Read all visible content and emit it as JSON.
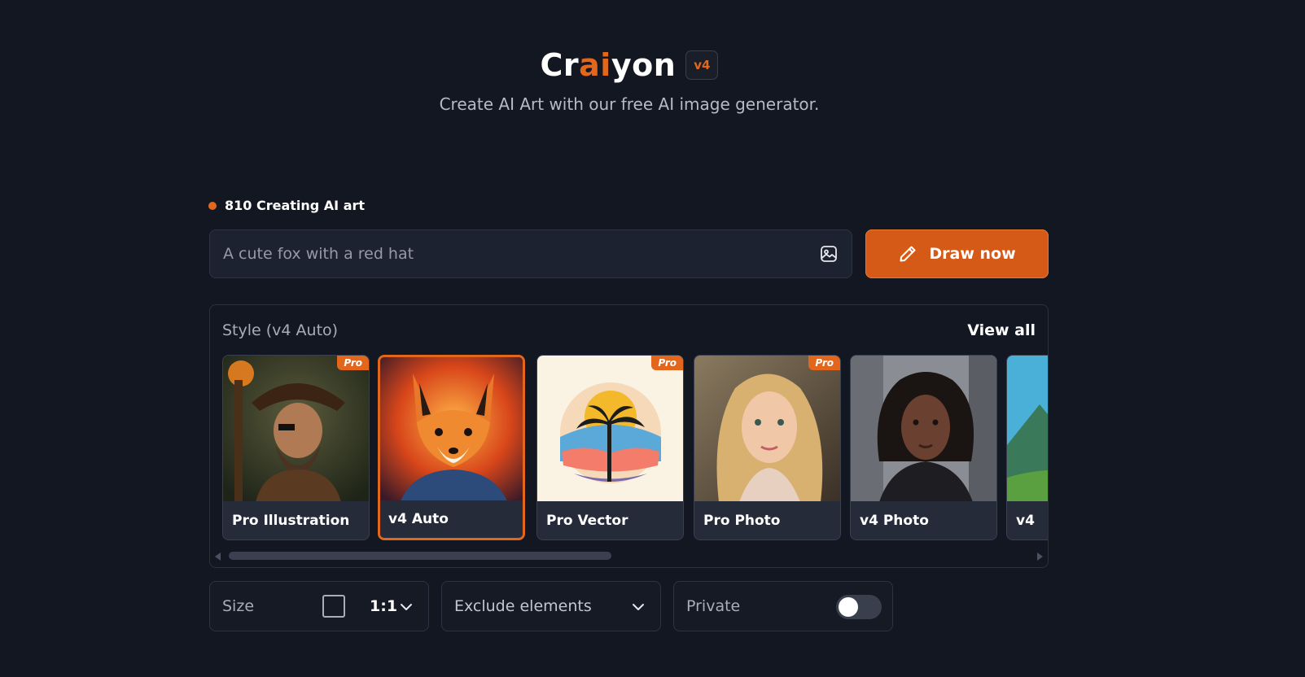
{
  "header": {
    "logo_part1": "Cr",
    "logo_part2": "ai",
    "logo_part3": "yon",
    "version_badge": "v4",
    "subtitle": "Create AI Art with our free AI image generator."
  },
  "status": {
    "count_text": "810 Creating AI art",
    "dot_color": "#e2661c"
  },
  "prompt": {
    "placeholder": "A cute fox with a red hat",
    "value": "",
    "image_icon": "image-upload-icon"
  },
  "draw_button": {
    "label": "Draw now",
    "icon": "pencil-icon",
    "color": "#d65a17"
  },
  "style_panel": {
    "title": "Style (v4 Auto)",
    "view_all": "View all",
    "pro_badge": "Pro",
    "cards": [
      {
        "label": "Pro Illustration",
        "pro": true,
        "selected": false,
        "image": "pirate-portrait-image"
      },
      {
        "label": "v4 Auto",
        "pro": false,
        "selected": true,
        "image": "fox-portrait-image"
      },
      {
        "label": "Pro Vector",
        "pro": true,
        "selected": false,
        "image": "palm-sunset-vector-image"
      },
      {
        "label": "Pro Photo",
        "pro": true,
        "selected": false,
        "image": "blonde-woman-photo-image"
      },
      {
        "label": "v4 Photo",
        "pro": false,
        "selected": false,
        "image": "woman-street-photo-image"
      },
      {
        "label": "v4",
        "pro": false,
        "selected": false,
        "image": "landscape-image"
      }
    ]
  },
  "options": {
    "size": {
      "label": "Size",
      "ratio": "1:1"
    },
    "exclude": {
      "label": "Exclude elements"
    },
    "private": {
      "label": "Private",
      "enabled": false
    }
  },
  "colors": {
    "background": "#131722",
    "accent": "#e2661c",
    "panel": "#1d2230"
  }
}
